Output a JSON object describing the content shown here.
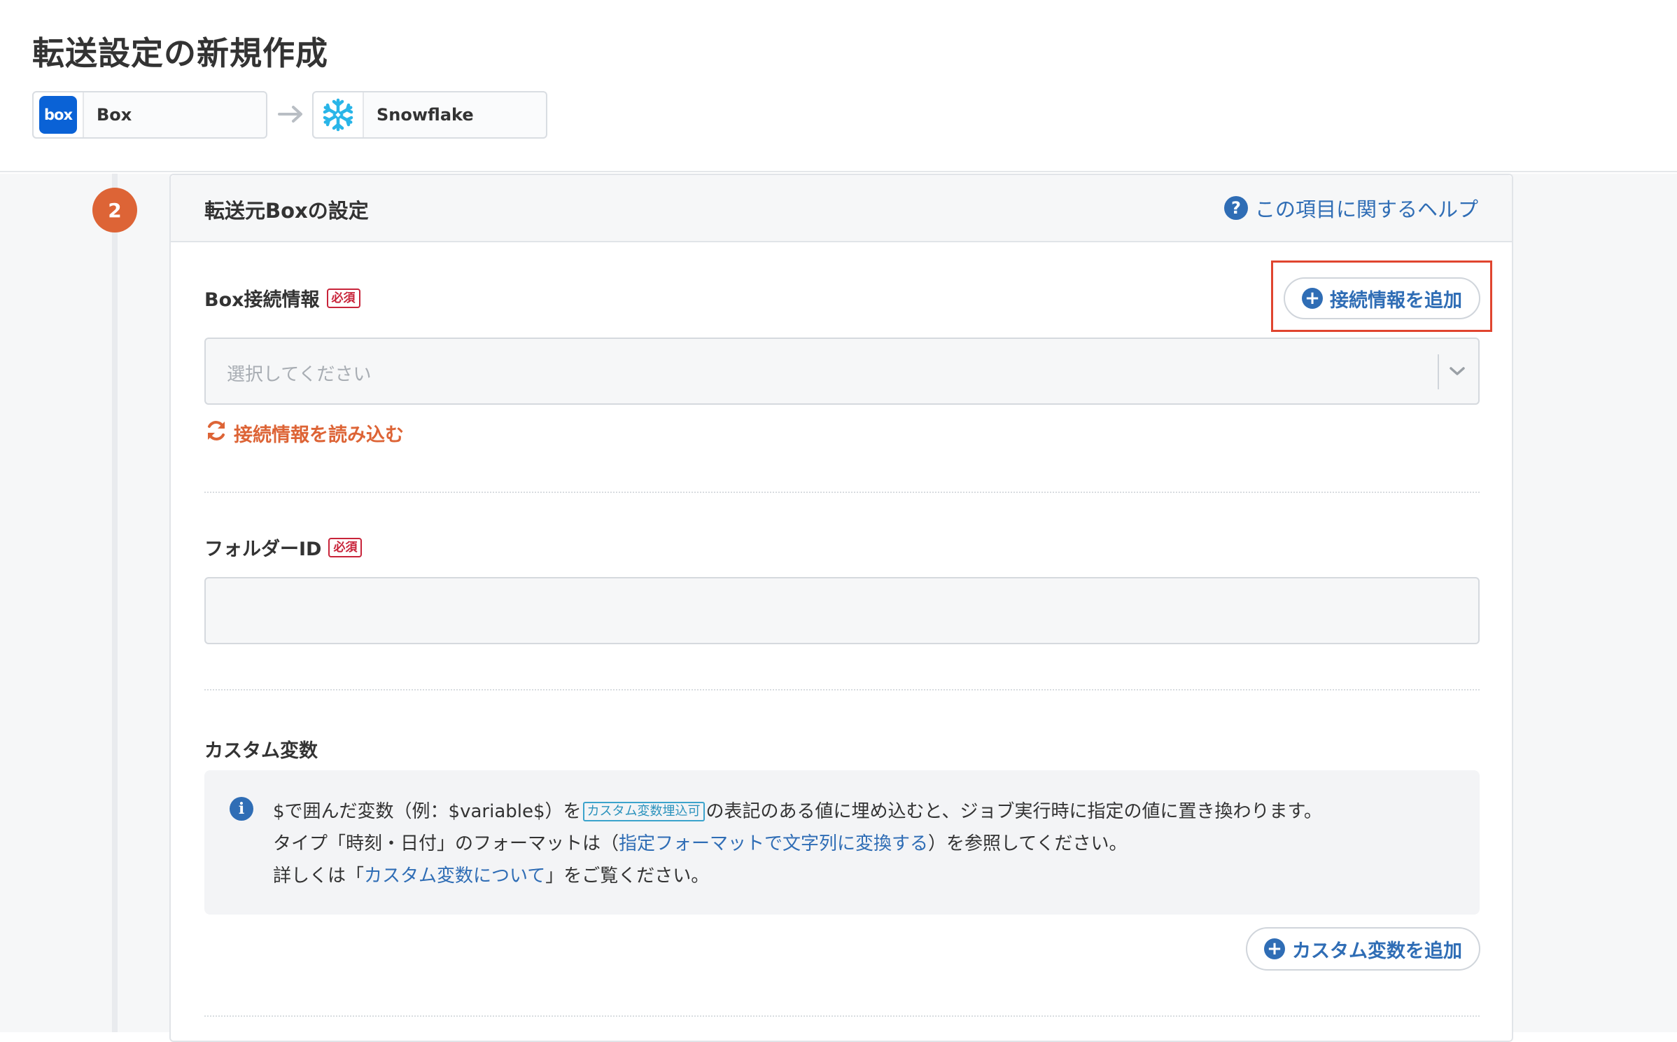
{
  "header": {
    "title": "転送設定の新規作成",
    "source": {
      "logo_text": "box",
      "name": "Box"
    },
    "destination": {
      "name": "Snowflake"
    }
  },
  "step": {
    "number": "2"
  },
  "card": {
    "title": "転送元Boxの設定",
    "help_label": "この項目に関するヘルプ",
    "help_icon_text": "?"
  },
  "connection_field": {
    "label": "Box接続情報",
    "required": "必須",
    "add_button": "接続情報を追加",
    "select_placeholder": "選択してください",
    "reload_link": "接続情報を読み込む"
  },
  "folder_field": {
    "label": "フォルダーID",
    "required": "必須",
    "value": ""
  },
  "custom_vars": {
    "label": "カスタム変数",
    "info_icon_text": "i",
    "line1_a": "$で囲んだ変数（例：$variable$）を",
    "line1_tag": "カスタム変数埋込可",
    "line1_b": "の表記のある値に埋め込むと、ジョブ実行時に指定の値に置き換わります。",
    "line2_a": "タイプ「時刻・日付」のフォーマットは（",
    "line2_link": "指定フォーマットで文字列に変換する",
    "line2_b": "）を参照してください。",
    "line3_a": "詳しくは「",
    "line3_link": "カスタム変数について",
    "line3_b": "」をご覧ください。",
    "add_button": "カスタム変数を追加"
  },
  "colors": {
    "accent_blue": "#2f6db5",
    "accent_orange": "#dd6436",
    "required_red": "#c8243a",
    "highlight_red": "#e0452f"
  }
}
